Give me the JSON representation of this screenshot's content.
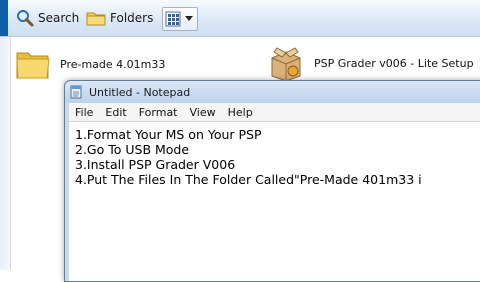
{
  "toolbar": {
    "search_label": "Search",
    "folders_label": "Folders",
    "search_icon": "search-icon",
    "folders_icon": "folder-icon",
    "views_icon": "views-icon"
  },
  "files": [
    {
      "name": "Pre-made 4.01m33",
      "icon": "folder-icon"
    },
    {
      "name": "PSP Grader v006 - Lite Setup",
      "icon": "installer-icon"
    }
  ],
  "notepad": {
    "title": "Untitled - Notepad",
    "menu": [
      "File",
      "Edit",
      "Format",
      "View",
      "Help"
    ],
    "lines": [
      "1.Format Your MS on Your PSP",
      "2.Go To USB Mode",
      "3.Install PSP Grader V006",
      "4.Put The Files In The Folder Called\"Pre-Made 401m33 i"
    ]
  },
  "colors": {
    "toolbar_edge": "#0f5fa8",
    "folder_yellow": "#f3cf5a",
    "window_frame": "#c9d9eb"
  }
}
